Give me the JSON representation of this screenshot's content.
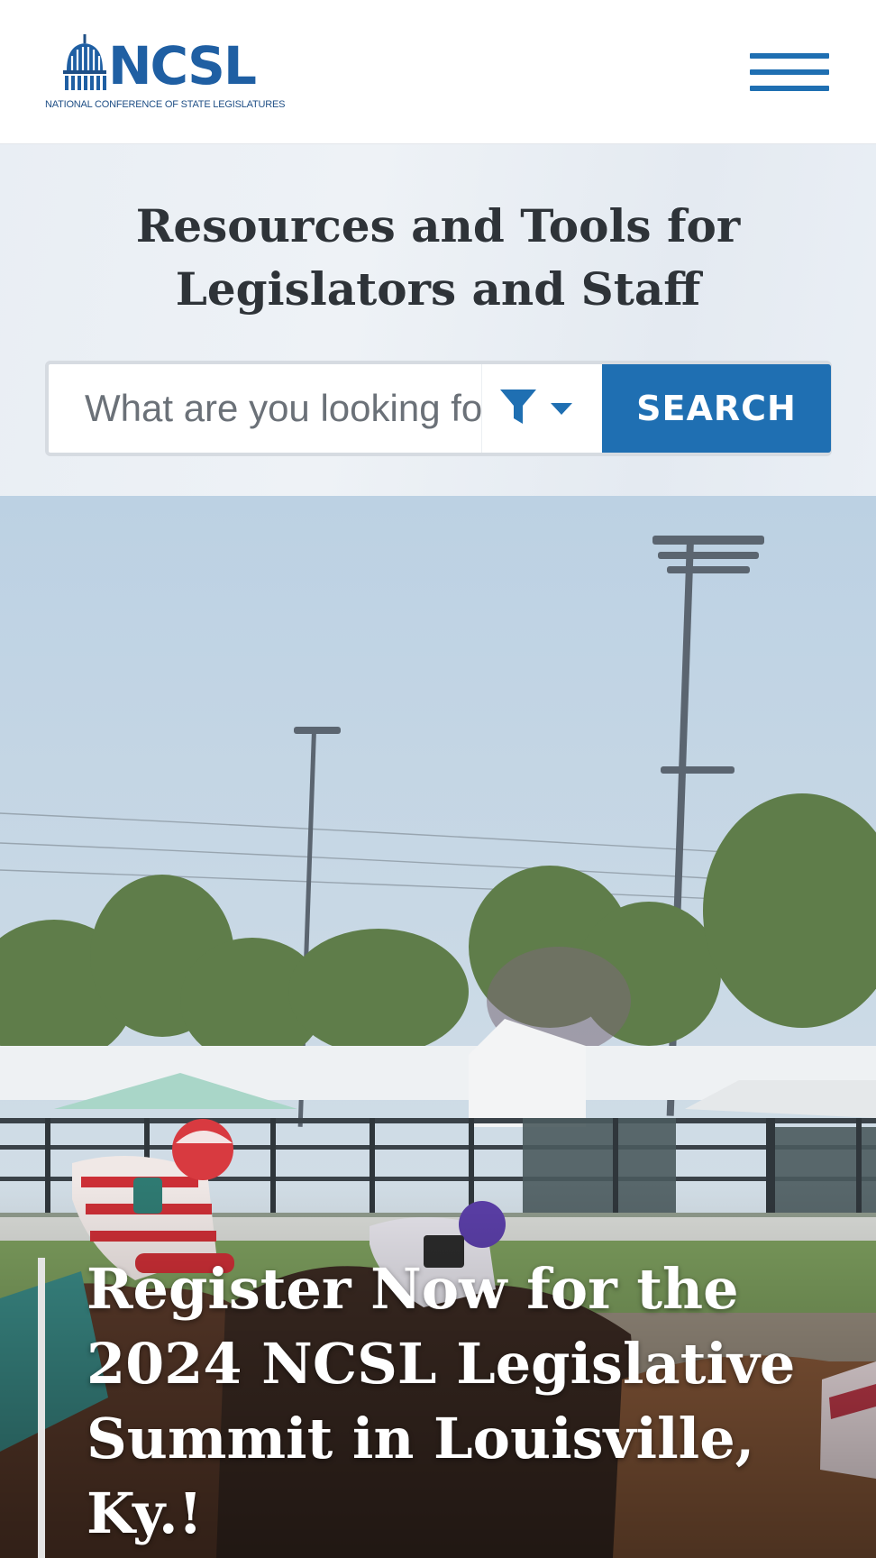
{
  "header": {
    "logo": {
      "wordmark": "NCSL",
      "subtitle": "NATIONAL CONFERENCE OF STATE LEGISLATURES",
      "icon": "capitol-dome-icon"
    },
    "menu_icon": "hamburger-menu-icon"
  },
  "hero": {
    "title": "Resources and Tools for Legislators and Staff"
  },
  "search": {
    "placeholder": "What are you looking for?",
    "filter_icon": "filter-icon",
    "dropdown_icon": "caret-down-icon",
    "button_label": "SEARCH"
  },
  "feature": {
    "image": "horse-racing-photo",
    "headline": "Register Now for the 2024 NCSL Legislative Summit in Louisville, Ky.!"
  },
  "colors": {
    "brand_blue": "#1f6fb2",
    "title_text": "#2e3338",
    "band_background": "#eaeff5"
  }
}
